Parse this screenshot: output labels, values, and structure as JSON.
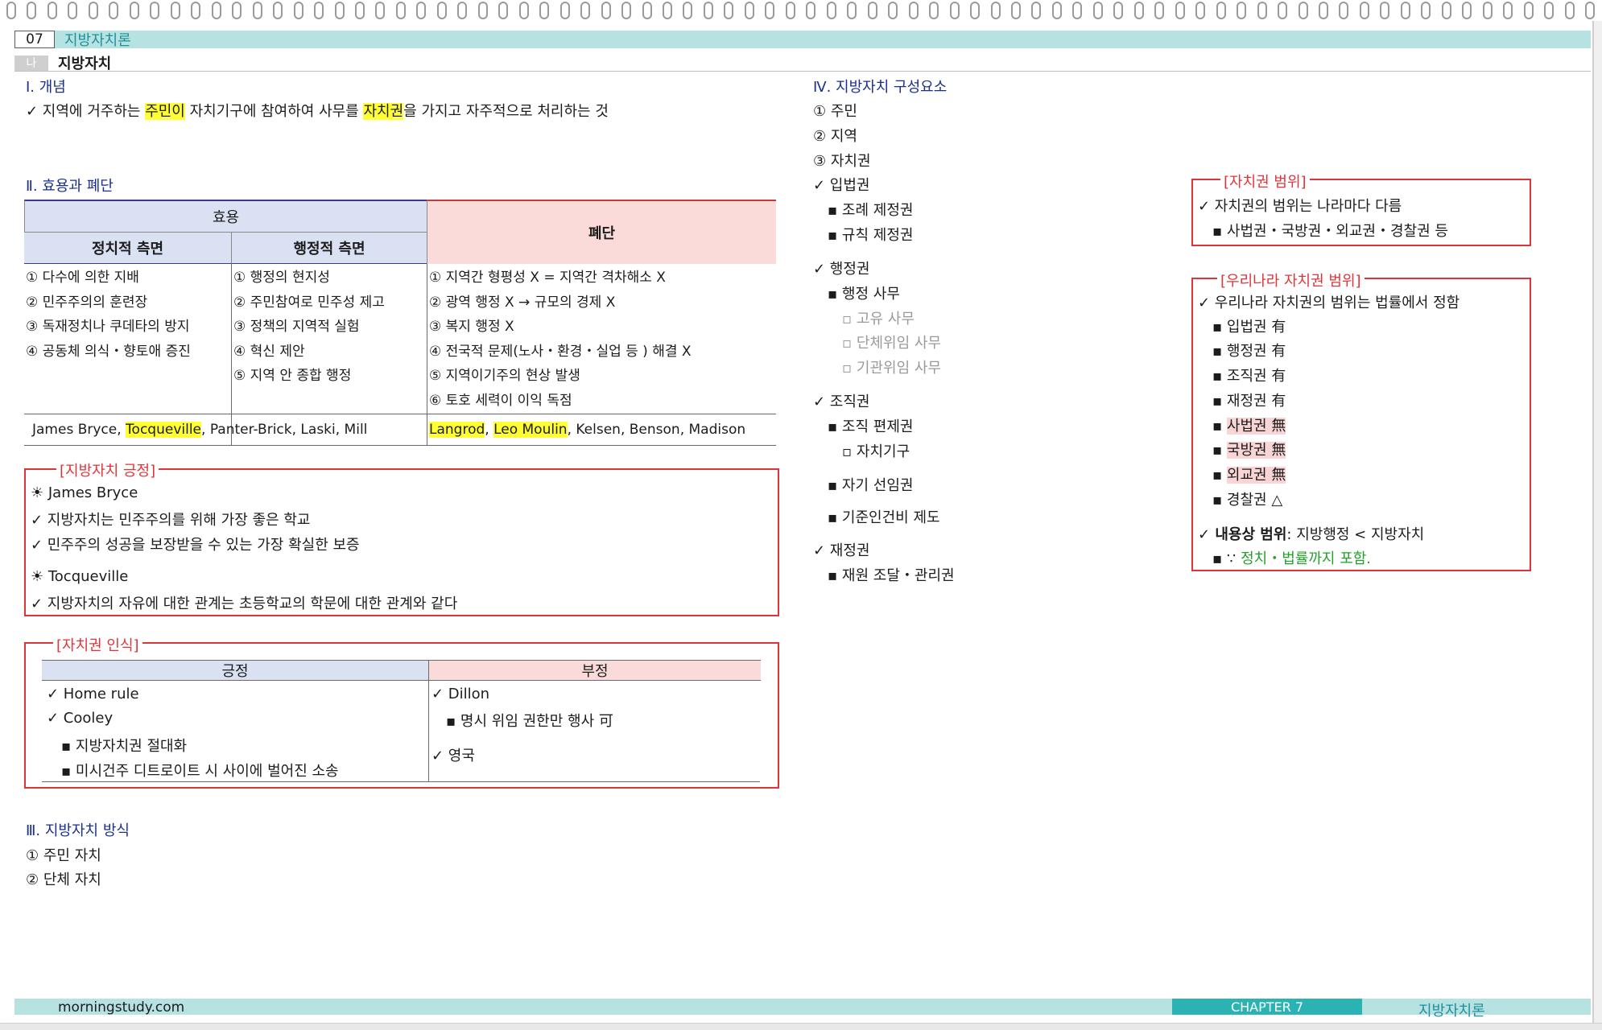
{
  "header": {
    "chapter_num": "07",
    "chapter_title": "지방자치론",
    "section_tag": "나",
    "section_title": "지방자치"
  },
  "s1": {
    "title": "Ⅰ. 개념",
    "line_pre": "✓ 지역에 거주하는 ",
    "hl1": "주민이",
    "line_mid": " 자치기구에 참여하여 사무를 ",
    "hl2": "자치권",
    "line_post": "을 가지고 자주적으로 처리하는 것"
  },
  "s2": {
    "title": "Ⅱ. 효용과 폐단",
    "table": {
      "h_merit": "효용",
      "h_demerit": "폐단",
      "h_pol": "정치적 측면",
      "h_adm": "행정적 측면",
      "pol": [
        "① 다수에 의한 지배",
        "② 민주주의의 훈련장",
        "③ 독재정치나 쿠데타의 방지",
        "④ 공동체 의식・향토애 증진"
      ],
      "adm": [
        "① 행정의 현지성",
        "② 주민참여로 민주성 제고",
        "③ 정책의 지역적 실험",
        "④ 혁신 제안",
        "⑤ 지역 안 종합 행정"
      ],
      "dem": [
        "① 지역간 형평성 X = 지역간 격차해소 X",
        "② 광역 행정 X → 규모의 경제 X",
        "③ 복지 행정 X",
        "④ 전국적 문제(노사・환경・실업 등 ) 해결 X",
        "⑤ 지역이기주의 현상 발생",
        "⑥ 토호 세력이 이익 독점"
      ],
      "sch_left_a": "James Bryce, ",
      "sch_left_hl": "Tocqueville",
      "sch_left_b": ", Panter-Brick, Laski, Mill",
      "sch_right_hl1": "Langrod",
      "sch_right_sep": ", ",
      "sch_right_hl2": "Leo Moulin",
      "sch_right_b": ", Kelsen, Benson, Madison"
    }
  },
  "box_positive": {
    "title": "[지방자치 긍정]",
    "l1": "☀ James Bryce",
    "l2": "✓ 지방자치는 민주주의를 위해 가장 좋은 학교",
    "l3": "✓ 민주주의 성공을 보장받을 수 있는 가장 확실한 보증",
    "l4": "☀ Tocqueville",
    "l5": "✓ 지방자치의 자유에 대한 관계는 초등학교의 학문에 대한 관계와 같다"
  },
  "box_recog": {
    "title": "[자치권 인식]",
    "h_pos": "긍정",
    "h_neg": "부정",
    "pos": [
      "✓ Home rule",
      "✓ Cooley",
      "▪ 지방자치권 절대화",
      "▪ 미시건주 디트로이트 시 사이에 벌어진 소송"
    ],
    "neg": [
      "✓ Dillon",
      "▪ 명시 위임 권한만 행사 可",
      "✓ 영국"
    ]
  },
  "s3": {
    "title": "Ⅲ. 지방자치 방식",
    "items": [
      "① 주민 자치",
      "② 단체 자치"
    ]
  },
  "s4": {
    "title": "Ⅳ. 지방자치 구성요소",
    "items": [
      "① 주민",
      "② 지역",
      "③ 자치권"
    ],
    "leg": "✓ 입법권",
    "leg_sub": [
      "▪ 조례 제정권",
      "▪ 규칙 제정권"
    ],
    "exe": "✓ 행정권",
    "exe_sub": "▪ 행정 사무",
    "exe_subsub": [
      "▫ 고유 사무",
      "▫ 단체위임 사무",
      "▫ 기관위임 사무"
    ],
    "org": "✓ 조직권",
    "org_sub1": "▪ 조직 편제권",
    "org_subsub": "▫ 자치기구",
    "org_sub2": "▪ 자기 선임권",
    "org_sub3": "▪ 기준인건비 제도",
    "fin": "✓ 재정권",
    "fin_sub": "▪ 재원 조달・관리권"
  },
  "box_scope": {
    "title": "[자치권 범위]",
    "l1": "✓ 자치권의 범위는 나라마다 다름",
    "l2": "▪ 사법권・국방권・외교권・경찰권 등"
  },
  "box_korea": {
    "title": "[우리나라 자치권 범위]",
    "l1": "✓ 우리나라 자치권의 범위는 법률에서 정함",
    "items": [
      "▪ 입법권 有",
      "▪ 행정권 有",
      "▪ 조직권 有",
      "▪ 재정권 有"
    ],
    "items_no": [
      "사법권 無",
      "국방권 無",
      "외교권 無"
    ],
    "police": "▪ 경찰권 △",
    "content_label": "✓ 내용상 범위",
    "content_rest": ": 지방행정 < 지방자치",
    "reason_pre": "▪ ∵ ",
    "reason": "정치・법률까지 포함."
  },
  "footer": {
    "site": "morningstudy.com",
    "chapter": "CHAPTER 7",
    "title": "지방자치론"
  },
  "colors": {
    "accent_teal": "#b7e2e2",
    "chapter_bar": "#2bb3b3",
    "merit_blue": "#d9e1f2",
    "demerit_pink": "#fbdada",
    "red_box": "#e0343a",
    "section_blue": "#1a2f8f"
  }
}
